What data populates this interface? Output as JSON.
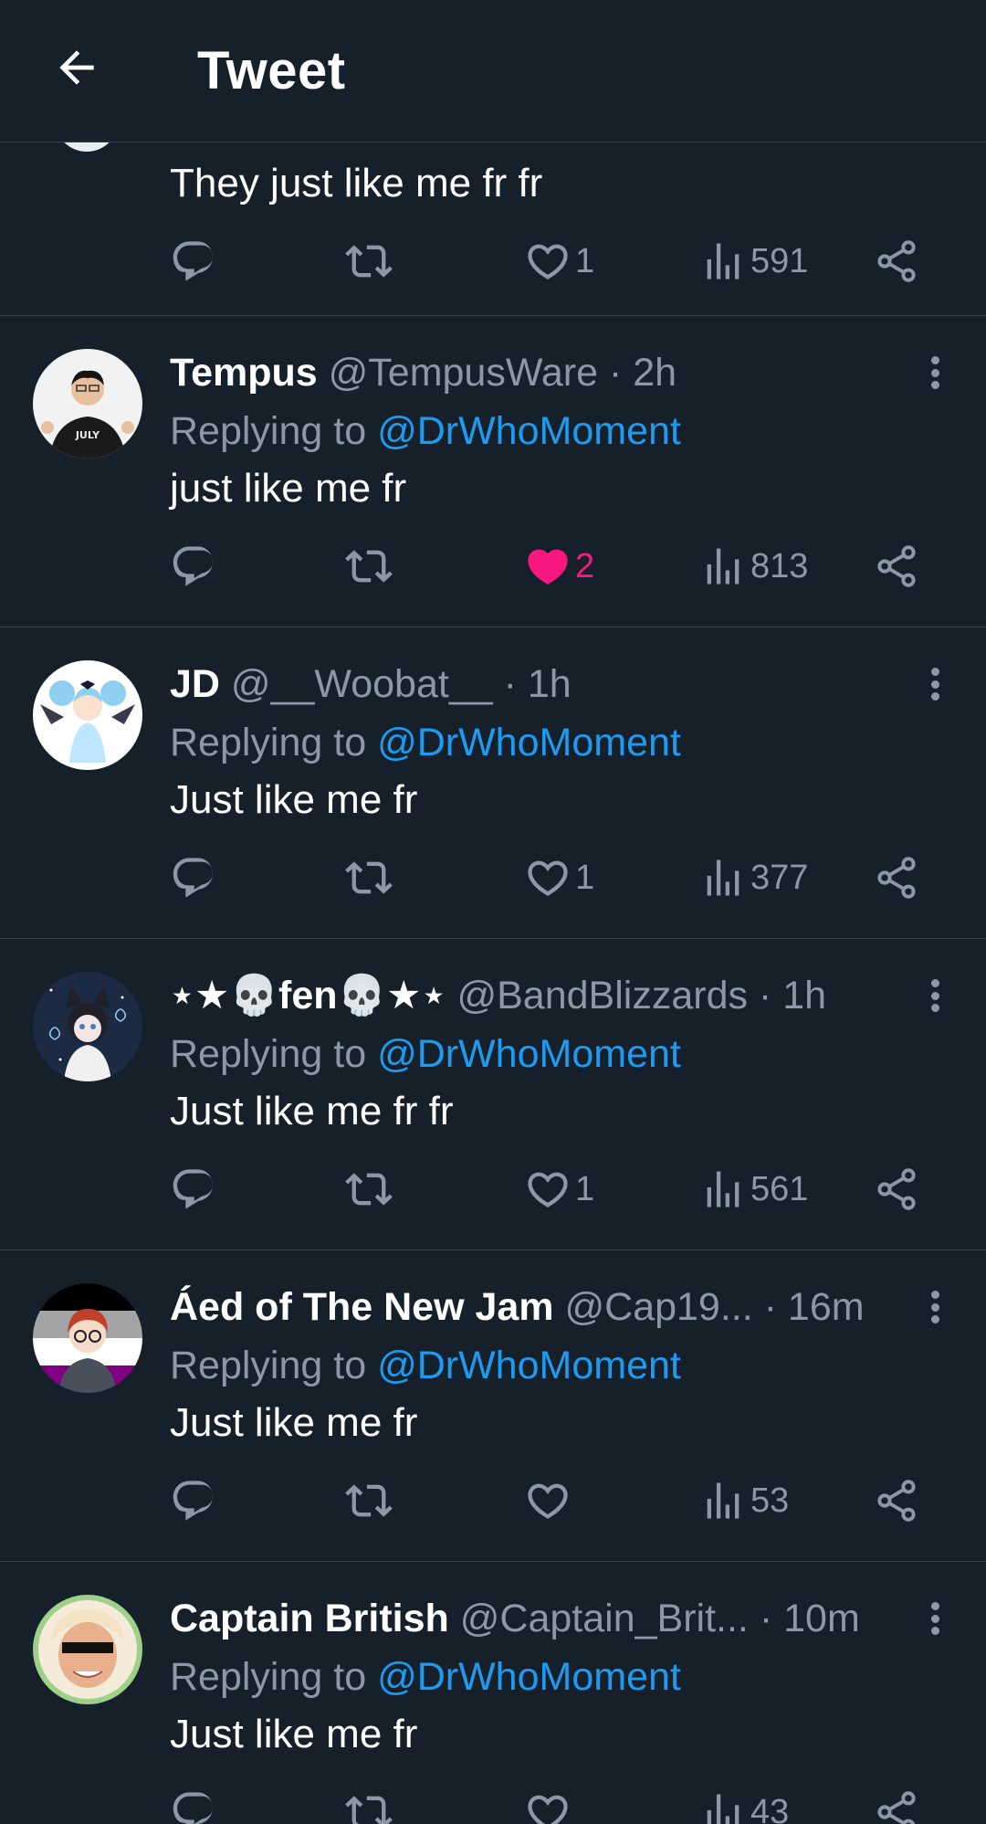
{
  "header": {
    "title": "Tweet"
  },
  "colors": {
    "background": "#15202b",
    "divider": "#38444d",
    "muted": "#8b98a5",
    "accent": "#1d9bf0",
    "like": "#f91880"
  },
  "first_tweet": {
    "text": "They just like me fr fr",
    "likes": "1",
    "views": "591"
  },
  "replies": [
    {
      "name": "Tempus",
      "handle": "@TempusWare",
      "dot": " · ",
      "time": "2h",
      "replying_prefix": "Replying to ",
      "replying_to": "@DrWhoMoment",
      "text": "just like me fr",
      "likes": "2",
      "views": "813"
    },
    {
      "name": "JD",
      "handle": "@__Woobat__",
      "dot": " · ",
      "time": "1h",
      "replying_prefix": "Replying to ",
      "replying_to": "@DrWhoMoment",
      "text": "Just like me fr",
      "likes": "1",
      "views": "377"
    },
    {
      "name": "⋆★💀fen💀★⋆",
      "handle": "@BandBlizzards",
      "dot": " · ",
      "time": "1h",
      "replying_prefix": "Replying to ",
      "replying_to": "@DrWhoMoment",
      "text": "Just like me fr fr",
      "likes": "1",
      "views": "561"
    },
    {
      "name": "Áed of The New Jam",
      "handle": "@Cap19...",
      "dot": "  · ",
      "time": "16m",
      "replying_prefix": "Replying to ",
      "replying_to": "@DrWhoMoment",
      "text": "Just like me fr",
      "likes": "",
      "views": "53"
    },
    {
      "name": "Captain British",
      "handle": "@Captain_Brit...",
      "dot": " · ",
      "time": "10m",
      "replying_prefix": "Replying to ",
      "replying_to": "@DrWhoMoment",
      "text": "Just like me fr",
      "likes": "",
      "views": "43"
    }
  ]
}
